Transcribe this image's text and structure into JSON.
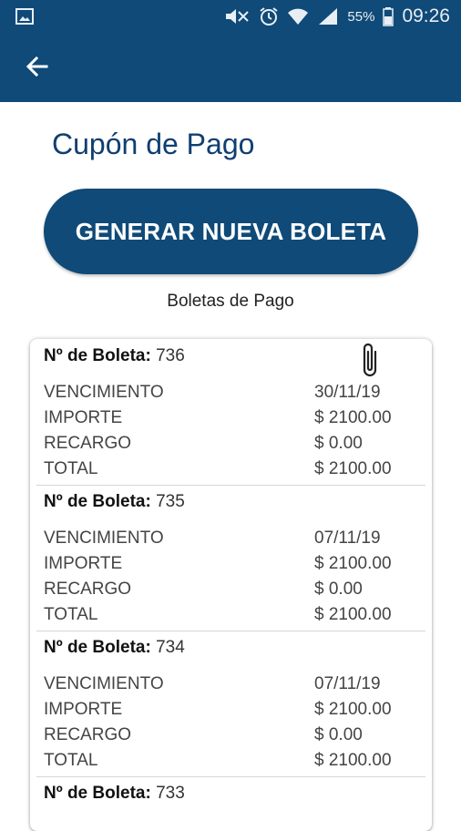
{
  "status_bar": {
    "battery": "55%",
    "time": "09:26",
    "icons": [
      "image-notification-icon",
      "mute-icon",
      "alarm-icon",
      "wifi-icon",
      "signal-icon",
      "battery-icon"
    ]
  },
  "header": {
    "back_icon": "arrow-left-icon"
  },
  "page": {
    "title": "Cupón de Pago",
    "generate_button": "GENERAR NUEVA BOLETA",
    "list_label": "Boletas de Pago"
  },
  "boletas": [
    {
      "heading": "Nº de Boleta:",
      "number": "736",
      "rows": [
        {
          "label": "VENCIMIENTO",
          "value": "30/11/19"
        },
        {
          "label": "IMPORTE",
          "value": "$ 2100.00"
        },
        {
          "label": "RECARGO",
          "value": "$ 0.00"
        },
        {
          "label": "TOTAL",
          "value": "$ 2100.00"
        }
      ]
    },
    {
      "heading": "Nº de Boleta:",
      "number": "735",
      "rows": [
        {
          "label": "VENCIMIENTO",
          "value": "07/11/19"
        },
        {
          "label": "IMPORTE",
          "value": "$ 2100.00"
        },
        {
          "label": "RECARGO",
          "value": "$ 0.00"
        },
        {
          "label": "TOTAL",
          "value": "$ 2100.00"
        }
      ]
    },
    {
      "heading": "Nº de Boleta:",
      "number": "734",
      "rows": [
        {
          "label": "VENCIMIENTO",
          "value": "07/11/19"
        },
        {
          "label": "IMPORTE",
          "value": "$ 2100.00"
        },
        {
          "label": "RECARGO",
          "value": "$ 0.00"
        },
        {
          "label": "TOTAL",
          "value": "$ 2100.00"
        }
      ]
    },
    {
      "heading": "Nº de Boleta:",
      "number": "733",
      "rows": []
    }
  ],
  "colors": {
    "primary": "#0f4a78",
    "title": "#0f3f72"
  }
}
